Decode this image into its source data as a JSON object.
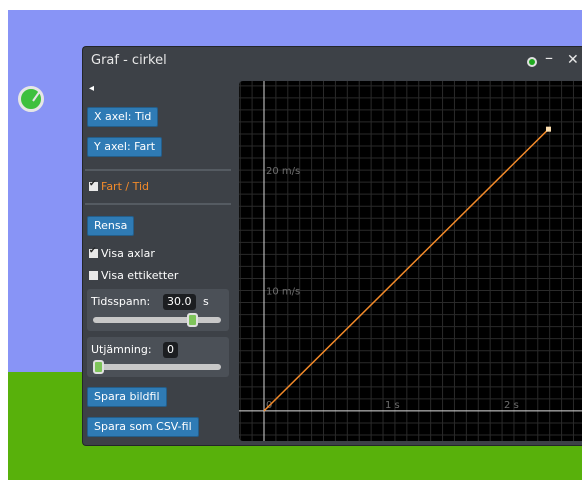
{
  "window": {
    "title": "Graf - cirkel",
    "controls": [
      "eye-icon",
      "minimize-icon",
      "close-icon"
    ]
  },
  "sidebar": {
    "back_icon": "◂",
    "x_axis_button": "X axel: Tid",
    "y_axis_button": "Y axel: Fart",
    "series_label": "Fart / Tid",
    "series_checked": true,
    "series_color": "#f28a2a",
    "clear_button": "Rensa",
    "show_axes_label": "Visa axlar",
    "show_axes_checked": true,
    "show_labels_label": "Visa ettiketter",
    "show_labels_checked": false,
    "timespan_label": "Tidsspann:",
    "timespan_value": "30.0",
    "timespan_unit": "s",
    "timespan_slider_fraction": 0.77,
    "smoothing_label": "Utjämning:",
    "smoothing_value": "0",
    "smoothing_slider_fraction": 0.0,
    "save_image_button": "Spara bildfil",
    "save_csv_button": "Spara som CSV-fil"
  },
  "colors": {
    "sky": "#8894f6",
    "ground": "#58b10b",
    "button": "#2f7bb5",
    "graph_bg": "#000000",
    "grid": "#2a2a2a",
    "series_line": "#f28a2a"
  },
  "chart_data": {
    "type": "line",
    "x_ticks": [
      {
        "value": 0,
        "label": "0"
      },
      {
        "value": 1,
        "label": "1 s"
      },
      {
        "value": 2,
        "label": "2 s"
      }
    ],
    "y_ticks": [
      {
        "value": 10,
        "label": "10 m/s"
      },
      {
        "value": 20,
        "label": "20 m/s"
      }
    ],
    "xlim": [
      -0.21,
      2.68
    ],
    "ylim": [
      -2.5,
      27.4
    ],
    "grid": true,
    "series": [
      {
        "name": "Fart / Tid",
        "x": [
          0,
          2.39
        ],
        "y": [
          0,
          23.4
        ]
      }
    ]
  }
}
